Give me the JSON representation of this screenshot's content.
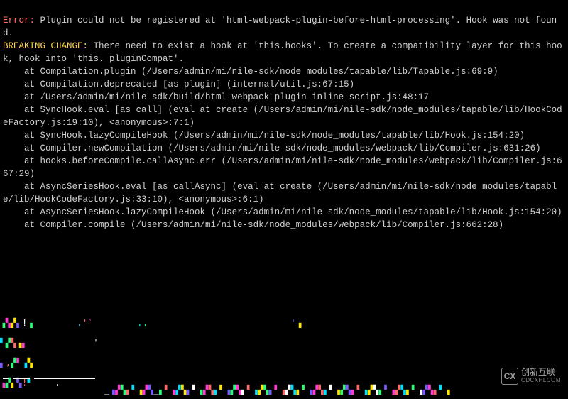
{
  "terminal": {
    "error_label": "Error:",
    "error_text": " Plugin could not be registered at 'html-webpack-plugin-before-html-processing'. Hook was not found.",
    "breaking_label": "BREAKING CHANGE:",
    "breaking_text": " There need to exist a hook at 'this.hooks'. To create a compatibility layer for this hook, hook into 'this._pluginCompat'.",
    "stack": [
      "    at Compilation.plugin (/Users/admin/mi/nile-sdk/node_modules/tapable/lib/Tapable.js:69:9)",
      "    at Compilation.deprecated [as plugin] (internal/util.js:67:15)",
      "    at /Users/admin/mi/nile-sdk/build/html-webpack-plugin-inline-script.js:48:17",
      "    at SyncHook.eval [as call] (eval at create (/Users/admin/mi/nile-sdk/node_modules/tapable/lib/HookCodeFactory.js:19:10), <anonymous>:7:1)",
      "    at SyncHook.lazyCompileHook (/Users/admin/mi/nile-sdk/node_modules/tapable/lib/Hook.js:154:20)",
      "    at Compiler.newCompilation (/Users/admin/mi/nile-sdk/node_modules/webpack/lib/Compiler.js:631:26)",
      "    at hooks.beforeCompile.callAsync.err (/Users/admin/mi/nile-sdk/node_modules/webpack/lib/Compiler.js:667:29)",
      "    at AsyncSeriesHook.eval [as callAsync] (eval at create (/Users/admin/mi/nile-sdk/node_modules/tapable/lib/HookCodeFactory.js:33:10), <anonymous>:6:1)",
      "    at AsyncSeriesHook.lazyCompileHook (/Users/admin/mi/nile-sdk/node_modules/tapable/lib/Hook.js:154:20)",
      "    at Compiler.compile (/Users/admin/mi/nile-sdk/node_modules/webpack/lib/Compiler.js:662:28)"
    ]
  },
  "watermark": {
    "logo_text": "CX",
    "brand": "创新互联",
    "domain": "CDCXHLCOM"
  }
}
